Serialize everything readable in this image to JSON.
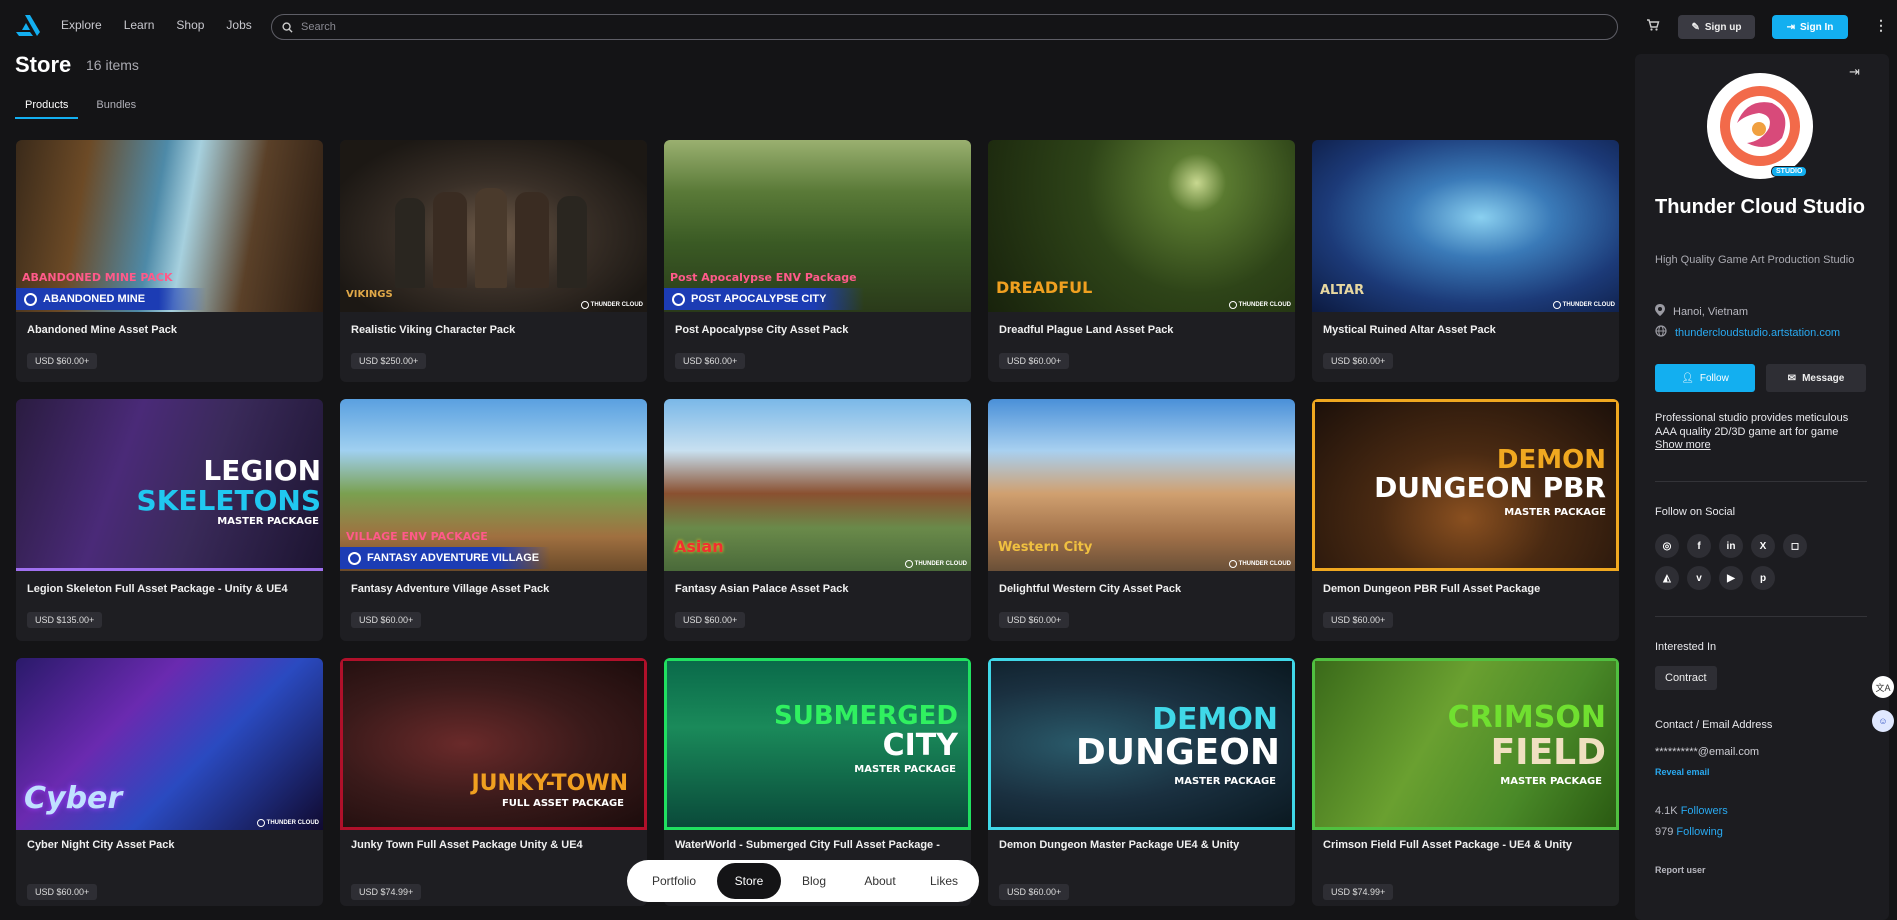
{
  "header": {
    "nav": [
      "Explore",
      "Learn",
      "Shop",
      "Jobs"
    ],
    "search_placeholder": "Search",
    "signup_label": "Sign up",
    "signin_label": "Sign In"
  },
  "store": {
    "title": "Store",
    "count": "16 items",
    "tabs": [
      "Products",
      "Bundles"
    ]
  },
  "products": [
    {
      "title": "Abandoned Mine Asset Pack",
      "price": "USD $60.00+",
      "overlay_small": "ABANDONED MINE PACK",
      "band": "ABANDONED MINE"
    },
    {
      "title": "Realistic Viking Character Pack",
      "price": "USD $250.00+",
      "overlay_small": "VIKINGS",
      "watermark": "THUNDER CLOUD"
    },
    {
      "title": "Post Apocalypse City Asset Pack",
      "price": "USD $60.00+",
      "overlay_small": "Post Apocalypse ENV Package",
      "band": "POST APOCALYPSE CITY"
    },
    {
      "title": "Dreadful Plague Land Asset Pack",
      "price": "USD $60.00+",
      "overlay_small": "DREADFUL",
      "watermark": "THUNDER CLOUD"
    },
    {
      "title": "Mystical Ruined Altar Asset Pack",
      "price": "USD $60.00+",
      "overlay_small": "ALTAR",
      "watermark": "THUNDER CLOUD"
    },
    {
      "title": "Legion Skeleton Full Asset Package - Unity & UE4",
      "price": "USD $135.00+",
      "big1": "LEGION",
      "big2": "SKELETONS",
      "sub": "MASTER PACKAGE"
    },
    {
      "title": "Fantasy Adventure Village Asset Pack",
      "price": "USD $60.00+",
      "overlay_small": "VILLAGE ENV PACKAGE",
      "band": "FANTASY ADVENTURE VILLAGE"
    },
    {
      "title": "Fantasy Asian Palace Asset Pack",
      "price": "USD $60.00+",
      "overlay_small": "Asian",
      "watermark": "THUNDER CLOUD"
    },
    {
      "title": "Delightful Western City Asset Pack",
      "price": "USD $60.00+",
      "overlay_small": "Western City",
      "watermark": "THUNDER CLOUD"
    },
    {
      "title": "Demon Dungeon PBR Full Asset Package",
      "price": "USD $60.00+",
      "big1": "DEMON",
      "big2": "DUNGEON PBR",
      "sub": "MASTER PACKAGE"
    },
    {
      "title": "Cyber Night City Asset Pack",
      "price": "USD $60.00+",
      "overlay_small": "Cyber",
      "watermark": "THUNDER CLOUD"
    },
    {
      "title": "Junky Town Full Asset Package Unity & UE4",
      "price": "USD $74.99+",
      "big1": "JUNKY-TOWN",
      "sub": "FULL ASSET PACKAGE"
    },
    {
      "title": "WaterWorld - Submerged City Full Asset Package - Unity & UE4",
      "price": "",
      "big1": "SUBMERGED",
      "big2": "CITY",
      "sub": "MASTER PACKAGE"
    },
    {
      "title": "Demon Dungeon Master Package UE4 & Unity",
      "price": "USD $60.00+",
      "big1": "DEMON",
      "big2": "DUNGEON",
      "sub": "MASTER PACKAGE"
    },
    {
      "title": "Crimson Field Full Asset Package - UE4 & Unity",
      "price": "USD $74.99+",
      "big1": "CRIMSON",
      "big2": "FIELD",
      "sub": "MASTER PACKAGE"
    }
  ],
  "bottom_nav": [
    "Portfolio",
    "Store",
    "Blog",
    "About",
    "Likes"
  ],
  "profile": {
    "badge": "STUDIO",
    "name": "Thunder Cloud Studio",
    "tagline": "High Quality Game Art Production Studio",
    "location": "Hanoi, Vietnam",
    "website": "thundercloudstudio.artstation.com",
    "follow_label": "Follow",
    "message_label": "Message",
    "bio": "Professional studio provides meticulous AAA quality 2D/3D game art for game",
    "show_more": "Show more",
    "social_heading": "Follow on Social",
    "interested_heading": "Interested In",
    "interest": "Contract",
    "contact_heading": "Contact / Email Address",
    "email": "**********@email.com",
    "reveal": "Reveal email",
    "followers_count": "4.1K",
    "followers_label": "Followers",
    "following_count": "979",
    "following_label": "Following",
    "report": "Report user"
  },
  "colors": {
    "accent": "#13aff0",
    "background": "#141416",
    "card": "#1e1e22"
  }
}
